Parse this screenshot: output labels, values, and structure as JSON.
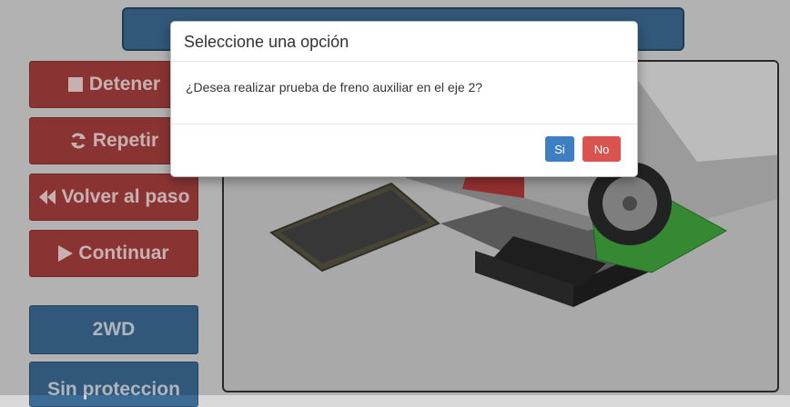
{
  "sidebar": {
    "buttons": [
      {
        "label": "Detener",
        "icon": "stop-icon"
      },
      {
        "label": "Repetir",
        "icon": "refresh-icon"
      },
      {
        "label": "Volver al paso",
        "icon": "backward-icon"
      },
      {
        "label": "Continuar",
        "icon": "play-icon"
      }
    ],
    "mode_button": "2WD",
    "protection_button": "Sin proteccion"
  },
  "modal": {
    "title": "Seleccione una opción",
    "message": "¿Desea realizar prueba de freno auxiliar en el eje 2?",
    "yes_label": "Si",
    "no_label": "No"
  },
  "colors": {
    "red_button": "#a8403f",
    "blue_button": "#3c6c96",
    "primary": "#3d7fc1",
    "danger": "#d9534f",
    "green_plate": "#3fa33c"
  }
}
